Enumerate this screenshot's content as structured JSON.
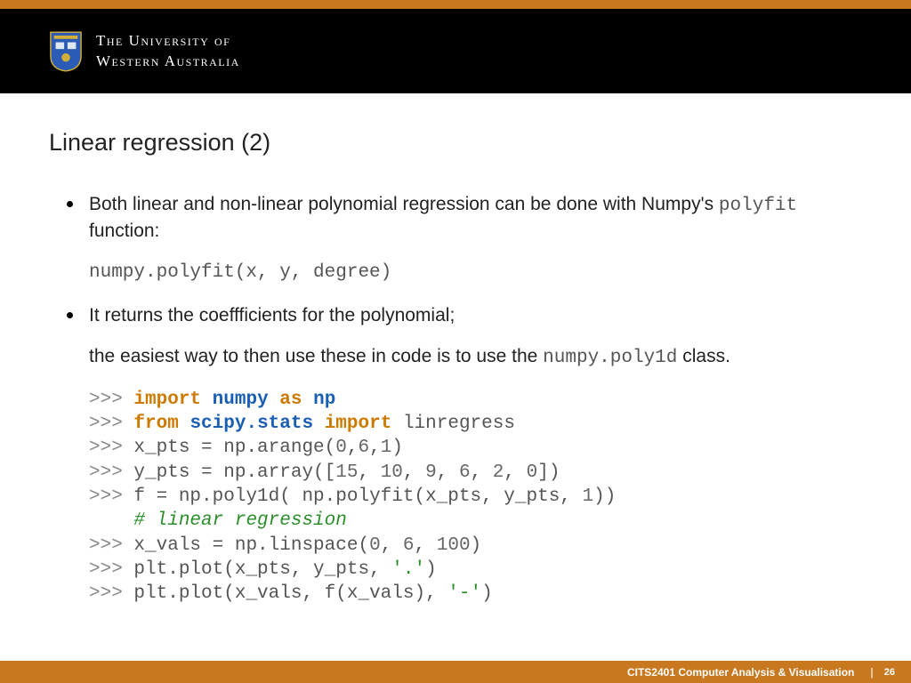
{
  "header": {
    "uni_line1": "The University of",
    "uni_line2": "Western Australia"
  },
  "slide": {
    "title": "Linear regression (2)",
    "bullet1_a": "Both linear and non-linear polynomial regression can be done with Numpy's ",
    "bullet1_code": "polyfit",
    "bullet1_b": " function:",
    "bullet1_sig": "numpy.polyfit(x, y, degree)",
    "bullet2_a": "It returns the coeffficients for the polynomial;",
    "bullet2_b_pre": "the easiest way to then use these in code is to use the ",
    "bullet2_b_code": "numpy.poly1d",
    "bullet2_b_post": " class."
  },
  "code": {
    "l1_prompt": ">>> ",
    "l1_import": "import",
    "l1_mod": "numpy",
    "l1_as": "as",
    "l1_alias": "np",
    "l2_prompt": ">>> ",
    "l2_from": "from",
    "l2_mod": "scipy",
    "l2_dot": ".",
    "l2_sub": "stats",
    "l2_import": "import",
    "l2_name": "linregress",
    "l3_prompt": ">>> ",
    "l3_txt": "x_pts = np.arange(",
    "l3_n1": "0",
    "l3_c1": ",",
    "l3_n2": "6",
    "l3_c2": ",",
    "l3_n3": "1",
    "l3_end": ")",
    "l4_prompt": ">>> ",
    "l4_txt": "y_pts = np.array([",
    "l4_n1": "15",
    "l4_c1": ", ",
    "l4_n2": "10",
    "l4_c2": ", ",
    "l4_n3": "9",
    "l4_c3": ", ",
    "l4_n4": "6",
    "l4_c4": ", ",
    "l4_n5": "2",
    "l4_c5": ", ",
    "l4_n6": "0",
    "l4_end": "])",
    "l5_prompt": ">>> ",
    "l5_txt": "f = np.poly1d( np.polyfit(x_pts, y_pts, ",
    "l5_n1": "1",
    "l5_end": "))",
    "l6_indent": "    ",
    "l6_comment": "# linear regression",
    "l7_prompt": ">>> ",
    "l7_txt": "x_vals = np.linspace(",
    "l7_n1": "0",
    "l7_c1": ", ",
    "l7_n2": "6",
    "l7_c2": ", ",
    "l7_n3": "100",
    "l7_end": ")",
    "l8_prompt": ">>> ",
    "l8_txt": "plt.plot(x_pts, y_pts, ",
    "l8_str": "'.'",
    "l8_end": ")",
    "l9_prompt": ">>> ",
    "l9_txt": "plt.plot(x_vals, f(x_vals), ",
    "l9_str": "'-'",
    "l9_end": ")"
  },
  "footer": {
    "course": "CITS2401 Computer Analysis & Visualisation",
    "divider": "|",
    "page": "26"
  }
}
